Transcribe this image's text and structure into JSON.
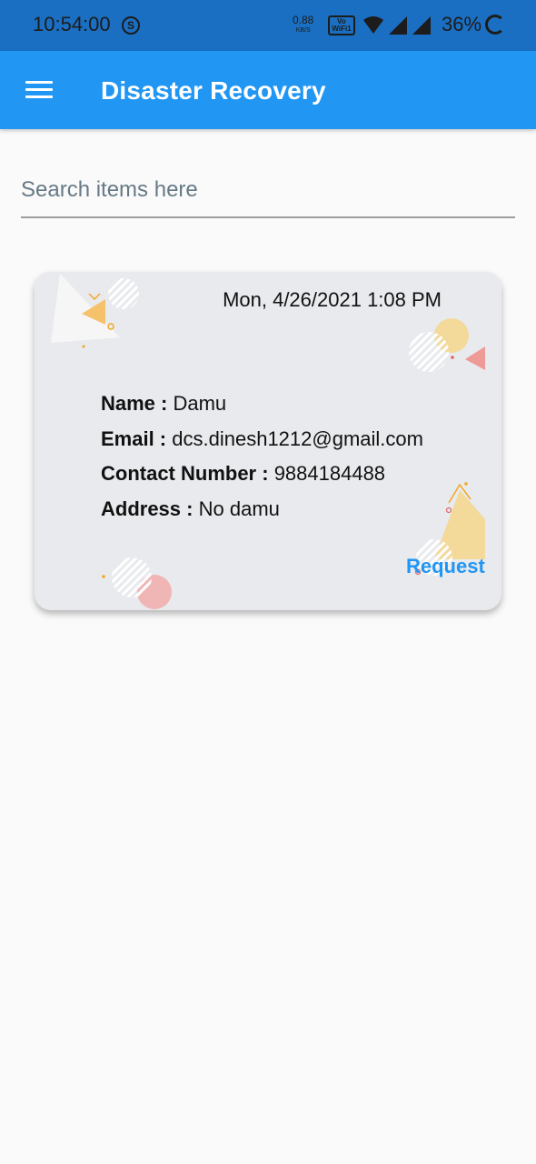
{
  "status_bar": {
    "time": "10:54:00",
    "s_badge": "S",
    "net_speed": "0.88",
    "net_unit": "KB/S",
    "vowifi_top": "Vo",
    "vowifi_bottom": "WiFi",
    "vowifi_sub": "1",
    "battery": "36%",
    "icons": [
      "wifi-icon",
      "signal-icon",
      "signal-icon",
      "battery-ring-icon"
    ]
  },
  "app_bar": {
    "title": "Disaster Recovery",
    "menu_icon": "hamburger-menu-icon"
  },
  "search": {
    "placeholder": "Search items here",
    "value": ""
  },
  "cards": [
    {
      "date": "Mon, 4/26/2021 1:08 PM",
      "name_label": "Name :",
      "name": "Damu",
      "email_label": "Email :",
      "email": "dcs.dinesh1212@gmail.com",
      "contact_label": "Contact Number :",
      "contact": "9884184488",
      "address_label": "Address :",
      "address": "No damu",
      "action_label": "Request"
    }
  ],
  "colors": {
    "status_bar": "#1b6fc2",
    "app_bar": "#2196f3",
    "accent": "#2196f3",
    "card_bg": "#e8eaed",
    "page_bg": "#fafafa"
  }
}
